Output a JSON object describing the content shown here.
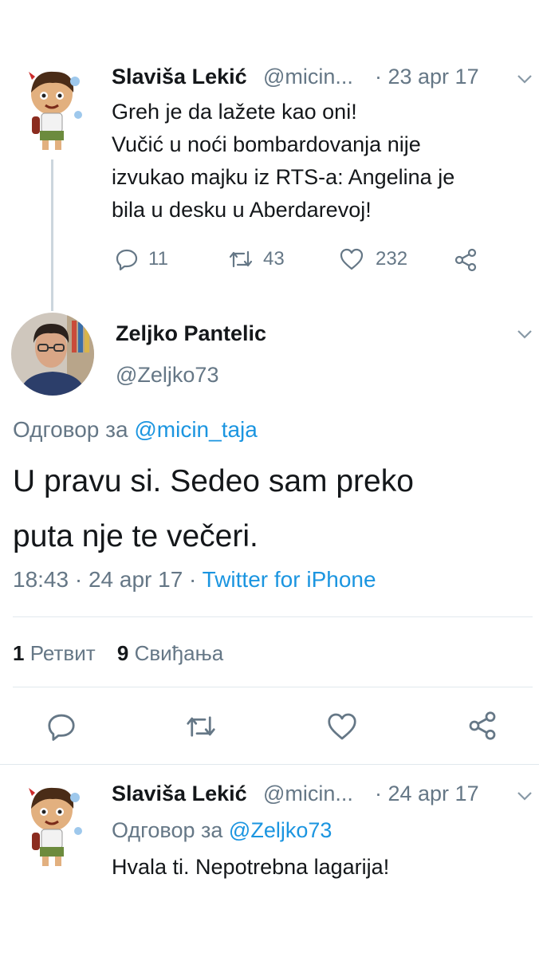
{
  "tweet1": {
    "author_name": "Slaviša Lekić",
    "author_handle": "@micin...",
    "date": "· 23 apr 17",
    "lines": [
      "Greh je da lažete kao oni!",
      "Vučić u noći bombardovanja nije",
      "izvukao majku iz RTS-a: Angelina je",
      "bila u desku u Aberdarevoj!"
    ],
    "replies": "11",
    "retweets": "43",
    "likes": "232",
    "icons": [
      "reply-icon",
      "retweet-icon",
      "like-icon",
      "share-icon"
    ]
  },
  "main_tweet": {
    "author_name": "Zeljko Pantelic",
    "author_handle": "@Zeljko73",
    "reply_prefix": "Одговор за",
    "reply_to": "@micin_taja",
    "lines": [
      "U pravu si. Sedeo sam preko",
      "puta nje te večeri."
    ],
    "time_date": "18:43 · 24 apr 17 ·",
    "source": "Twitter for iPhone",
    "retweet_count": "1",
    "retweet_label": "Ретвит",
    "like_count": "9",
    "like_label": "Свиђања"
  },
  "tweet3": {
    "author_name": "Slaviša Lekić",
    "author_handle": "@micin...",
    "date": "· 24 apr 17",
    "reply_prefix": "Одговор за",
    "reply_to": "@Zeljko73",
    "text": "Hvala ti. Nepotrebna lagarija!"
  },
  "colors": {
    "text": "#14171a",
    "secondary": "#657786",
    "link": "#1b95e0",
    "divider": "#e1e8ed"
  }
}
